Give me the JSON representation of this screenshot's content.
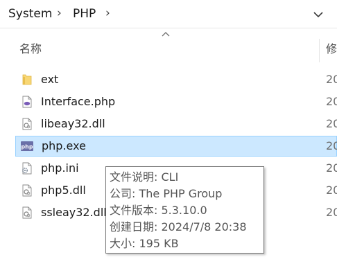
{
  "breadcrumb": {
    "items": [
      "System",
      "PHP"
    ],
    "separator": "›"
  },
  "header": {
    "name_label": "名称",
    "date_label": "修"
  },
  "files": [
    {
      "name": "ext",
      "date": "20",
      "icon": "folder-icon"
    },
    {
      "name": "Interface.php",
      "date": "20",
      "icon": "php-file-icon"
    },
    {
      "name": "libeay32.dll",
      "date": "20",
      "icon": "dll-file-icon"
    },
    {
      "name": "php.exe",
      "date": "20",
      "icon": "php-exe-icon",
      "selected": true
    },
    {
      "name": "php.ini",
      "date": "20",
      "icon": "ini-file-icon"
    },
    {
      "name": "php5.dll",
      "date": "20",
      "icon": "dll-file-icon"
    },
    {
      "name": "ssleay32.dll",
      "date": "20",
      "icon": "dll-file-icon"
    }
  ],
  "tooltip": {
    "description": "文件说明: CLI",
    "company": "公司: The PHP Group",
    "version": "文件版本: 5.3.10.0",
    "created": "创建日期: 2024/7/8 20:38",
    "size": "大小: 195 KB"
  },
  "colors": {
    "selection_bg": "#cce8ff",
    "selection_border": "#99d1ff",
    "folder": "#f8d775"
  }
}
